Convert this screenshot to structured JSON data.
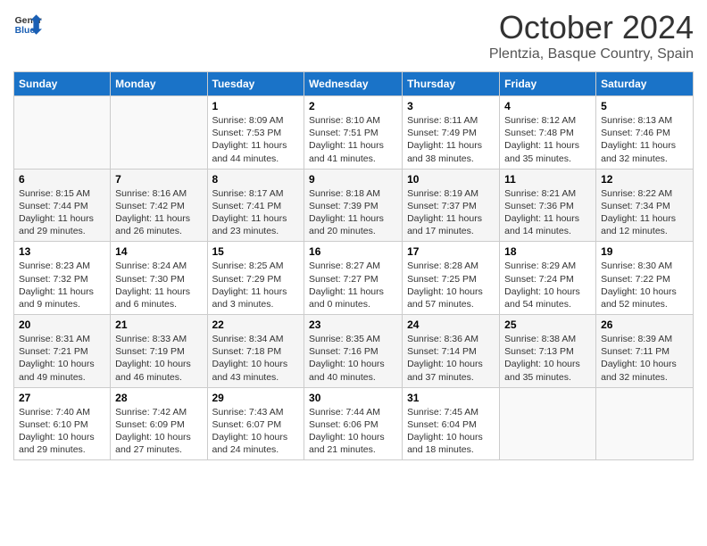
{
  "logo": {
    "general": "General",
    "blue": "Blue"
  },
  "title": "October 2024",
  "location": "Plentzia, Basque Country, Spain",
  "weekdays": [
    "Sunday",
    "Monday",
    "Tuesday",
    "Wednesday",
    "Thursday",
    "Friday",
    "Saturday"
  ],
  "weeks": [
    [
      {
        "day": "",
        "info": ""
      },
      {
        "day": "",
        "info": ""
      },
      {
        "day": "1",
        "info": "Sunrise: 8:09 AM\nSunset: 7:53 PM\nDaylight: 11 hours and 44 minutes."
      },
      {
        "day": "2",
        "info": "Sunrise: 8:10 AM\nSunset: 7:51 PM\nDaylight: 11 hours and 41 minutes."
      },
      {
        "day": "3",
        "info": "Sunrise: 8:11 AM\nSunset: 7:49 PM\nDaylight: 11 hours and 38 minutes."
      },
      {
        "day": "4",
        "info": "Sunrise: 8:12 AM\nSunset: 7:48 PM\nDaylight: 11 hours and 35 minutes."
      },
      {
        "day": "5",
        "info": "Sunrise: 8:13 AM\nSunset: 7:46 PM\nDaylight: 11 hours and 32 minutes."
      }
    ],
    [
      {
        "day": "6",
        "info": "Sunrise: 8:15 AM\nSunset: 7:44 PM\nDaylight: 11 hours and 29 minutes."
      },
      {
        "day": "7",
        "info": "Sunrise: 8:16 AM\nSunset: 7:42 PM\nDaylight: 11 hours and 26 minutes."
      },
      {
        "day": "8",
        "info": "Sunrise: 8:17 AM\nSunset: 7:41 PM\nDaylight: 11 hours and 23 minutes."
      },
      {
        "day": "9",
        "info": "Sunrise: 8:18 AM\nSunset: 7:39 PM\nDaylight: 11 hours and 20 minutes."
      },
      {
        "day": "10",
        "info": "Sunrise: 8:19 AM\nSunset: 7:37 PM\nDaylight: 11 hours and 17 minutes."
      },
      {
        "day": "11",
        "info": "Sunrise: 8:21 AM\nSunset: 7:36 PM\nDaylight: 11 hours and 14 minutes."
      },
      {
        "day": "12",
        "info": "Sunrise: 8:22 AM\nSunset: 7:34 PM\nDaylight: 11 hours and 12 minutes."
      }
    ],
    [
      {
        "day": "13",
        "info": "Sunrise: 8:23 AM\nSunset: 7:32 PM\nDaylight: 11 hours and 9 minutes."
      },
      {
        "day": "14",
        "info": "Sunrise: 8:24 AM\nSunset: 7:30 PM\nDaylight: 11 hours and 6 minutes."
      },
      {
        "day": "15",
        "info": "Sunrise: 8:25 AM\nSunset: 7:29 PM\nDaylight: 11 hours and 3 minutes."
      },
      {
        "day": "16",
        "info": "Sunrise: 8:27 AM\nSunset: 7:27 PM\nDaylight: 11 hours and 0 minutes."
      },
      {
        "day": "17",
        "info": "Sunrise: 8:28 AM\nSunset: 7:25 PM\nDaylight: 10 hours and 57 minutes."
      },
      {
        "day": "18",
        "info": "Sunrise: 8:29 AM\nSunset: 7:24 PM\nDaylight: 10 hours and 54 minutes."
      },
      {
        "day": "19",
        "info": "Sunrise: 8:30 AM\nSunset: 7:22 PM\nDaylight: 10 hours and 52 minutes."
      }
    ],
    [
      {
        "day": "20",
        "info": "Sunrise: 8:31 AM\nSunset: 7:21 PM\nDaylight: 10 hours and 49 minutes."
      },
      {
        "day": "21",
        "info": "Sunrise: 8:33 AM\nSunset: 7:19 PM\nDaylight: 10 hours and 46 minutes."
      },
      {
        "day": "22",
        "info": "Sunrise: 8:34 AM\nSunset: 7:18 PM\nDaylight: 10 hours and 43 minutes."
      },
      {
        "day": "23",
        "info": "Sunrise: 8:35 AM\nSunset: 7:16 PM\nDaylight: 10 hours and 40 minutes."
      },
      {
        "day": "24",
        "info": "Sunrise: 8:36 AM\nSunset: 7:14 PM\nDaylight: 10 hours and 37 minutes."
      },
      {
        "day": "25",
        "info": "Sunrise: 8:38 AM\nSunset: 7:13 PM\nDaylight: 10 hours and 35 minutes."
      },
      {
        "day": "26",
        "info": "Sunrise: 8:39 AM\nSunset: 7:11 PM\nDaylight: 10 hours and 32 minutes."
      }
    ],
    [
      {
        "day": "27",
        "info": "Sunrise: 7:40 AM\nSunset: 6:10 PM\nDaylight: 10 hours and 29 minutes."
      },
      {
        "day": "28",
        "info": "Sunrise: 7:42 AM\nSunset: 6:09 PM\nDaylight: 10 hours and 27 minutes."
      },
      {
        "day": "29",
        "info": "Sunrise: 7:43 AM\nSunset: 6:07 PM\nDaylight: 10 hours and 24 minutes."
      },
      {
        "day": "30",
        "info": "Sunrise: 7:44 AM\nSunset: 6:06 PM\nDaylight: 10 hours and 21 minutes."
      },
      {
        "day": "31",
        "info": "Sunrise: 7:45 AM\nSunset: 6:04 PM\nDaylight: 10 hours and 18 minutes."
      },
      {
        "day": "",
        "info": ""
      },
      {
        "day": "",
        "info": ""
      }
    ]
  ]
}
